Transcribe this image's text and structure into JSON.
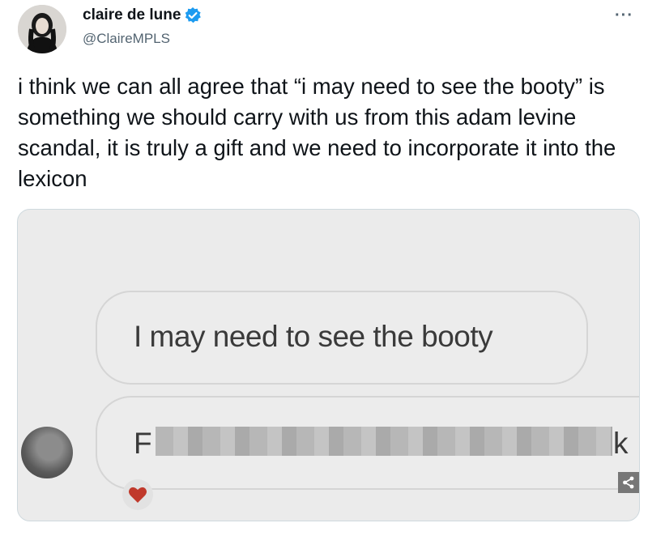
{
  "tweet": {
    "display_name": "claire de lune",
    "handle": "@ClaireMPLS",
    "more_label": "···",
    "text": "i think we can all agree that “i may need to see the booty” is something we should carry with us from this adam levine scandal, it is truly a gift and we need to incorporate it into the lexicon"
  },
  "media": {
    "message_1": "I may need to see the booty",
    "message_2_start": "F",
    "message_2_end": "k"
  },
  "icons": {
    "verified": "verified-badge-icon",
    "share": "share-icon",
    "reaction": "heart-icon"
  },
  "colors": {
    "verified": "#1d9bf0",
    "handle": "#536471",
    "reaction": "#c0392b"
  }
}
